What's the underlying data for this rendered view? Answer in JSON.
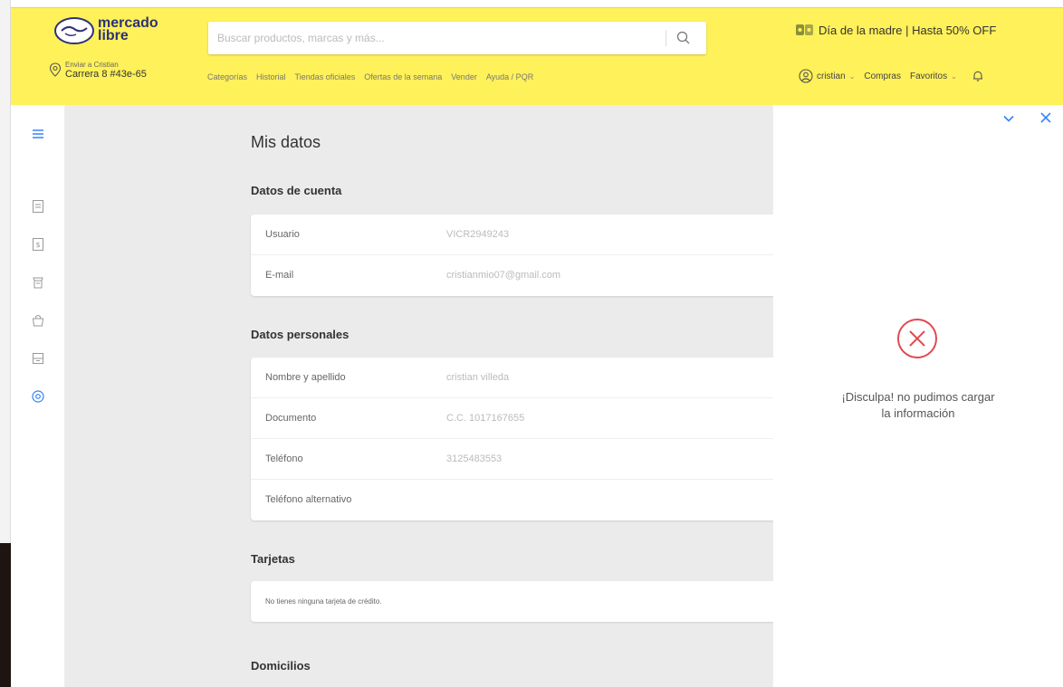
{
  "header": {
    "logo_line1": "mercado",
    "logo_line2": "libre",
    "search_placeholder": "Buscar productos, marcas y más...",
    "promo": "Día de la madre | Hasta 50% OFF",
    "location_small": "Enviar a Cristian",
    "location_big": "Carrera 8 #43e-65",
    "nav": [
      "Categorías",
      "Historial",
      "Tiendas oficiales",
      "Ofertas de la semana",
      "Vender",
      "Ayuda / PQR"
    ],
    "user": "cristian",
    "compras": "Compras",
    "favoritos": "Favoritos"
  },
  "page": {
    "title": "Mis datos",
    "cuenta": {
      "title": "Datos de cuenta",
      "rows": [
        {
          "label": "Usuario",
          "value": "VICR2949243"
        },
        {
          "label": "E-mail",
          "value": "cristianmio07@gmail.com"
        }
      ]
    },
    "personales": {
      "title": "Datos personales",
      "rows": [
        {
          "label": "Nombre y apellido",
          "value": "cristian villeda"
        },
        {
          "label": "Documento",
          "value": "C.C. 1017167655"
        },
        {
          "label": "Teléfono",
          "value": "3125483553"
        },
        {
          "label": "Teléfono alternativo",
          "value": ""
        }
      ]
    },
    "tarjetas": {
      "title": "Tarjetas",
      "empty": "No tienes ninguna tarjeta de crédito."
    },
    "domicilios": {
      "title": "Domicilios"
    }
  },
  "panel": {
    "message_line1": "¡Disculpa! no pudimos cargar",
    "message_line2": "la información"
  },
  "colors": {
    "brand_yellow": "#fff159",
    "brand_blue": "#3483fa",
    "error_red": "#e0494f"
  },
  "icons": [
    "search-icon",
    "pin-icon",
    "promo-icon",
    "avatar-icon",
    "bell-icon",
    "menu-icon",
    "chevron-down-icon",
    "close-icon",
    "error-icon"
  ]
}
